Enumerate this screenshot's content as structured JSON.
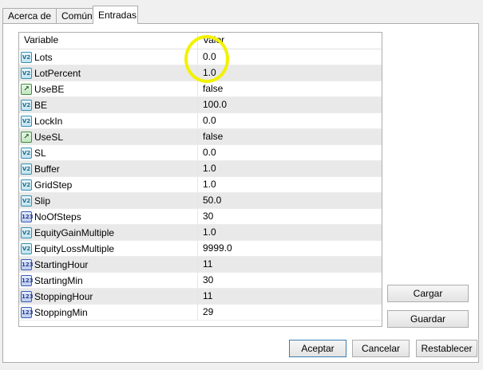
{
  "tabs": [
    {
      "label": "Acerca de"
    },
    {
      "label": "Común"
    },
    {
      "label": "Entradas"
    }
  ],
  "grid": {
    "columns": {
      "variable": "Variable",
      "value": "Valor"
    },
    "rows": [
      {
        "name": "Lots",
        "value": "0.0",
        "icon": "double-type-icon"
      },
      {
        "name": "LotPercent",
        "value": "1.0",
        "icon": "double-type-icon"
      },
      {
        "name": "UseBE",
        "value": "false",
        "icon": "bool-type-icon"
      },
      {
        "name": "BE",
        "value": "100.0",
        "icon": "double-type-icon"
      },
      {
        "name": "LockIn",
        "value": "0.0",
        "icon": "double-type-icon"
      },
      {
        "name": "UseSL",
        "value": "false",
        "icon": "bool-type-icon"
      },
      {
        "name": "SL",
        "value": "0.0",
        "icon": "double-type-icon"
      },
      {
        "name": "Buffer",
        "value": "1.0",
        "icon": "double-type-icon"
      },
      {
        "name": "GridStep",
        "value": "1.0",
        "icon": "double-type-icon"
      },
      {
        "name": "Slip",
        "value": "50.0",
        "icon": "double-type-icon"
      },
      {
        "name": "NoOfSteps",
        "value": "30",
        "icon": "int-type-icon"
      },
      {
        "name": "EquityGainMultiple",
        "value": "1.0",
        "icon": "double-type-icon"
      },
      {
        "name": "EquityLossMultiple",
        "value": "9999.0",
        "icon": "double-type-icon"
      },
      {
        "name": "StartingHour",
        "value": "11",
        "icon": "int-type-icon"
      },
      {
        "name": "StartingMin",
        "value": "30",
        "icon": "int-type-icon"
      },
      {
        "name": "StoppingHour",
        "value": "11",
        "icon": "int-type-icon"
      },
      {
        "name": "StoppingMin",
        "value": "29",
        "icon": "int-type-icon"
      }
    ]
  },
  "icon_glyphs": {
    "double-type-icon": "V2",
    "bool-type-icon": "↗",
    "int-type-icon": "123"
  },
  "buttons": {
    "load": "Cargar",
    "save": "Guardar",
    "accept": "Aceptar",
    "cancel": "Cancelar",
    "reset": "Restablecer"
  },
  "colors": {
    "highlight_circle": "#f2f200",
    "alt_row": "#e9e9e9"
  }
}
